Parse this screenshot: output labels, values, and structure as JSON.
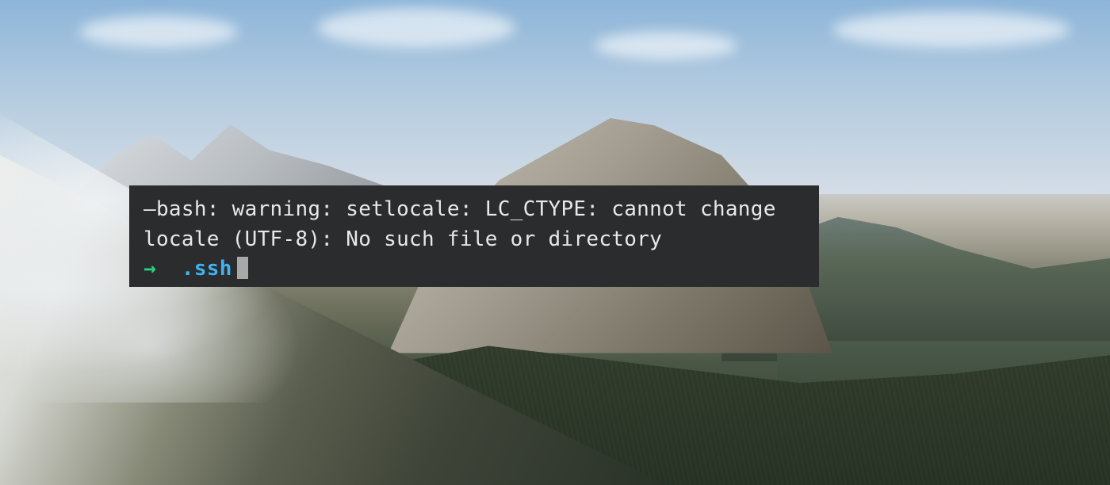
{
  "terminal": {
    "output_line_1": "—bash: warning: setlocale: LC_CTYPE: cannot change",
    "output_line_2": "locale (UTF-8): No such file or directory",
    "prompt_symbol": "→",
    "prompt_cwd": ".ssh",
    "colors": {
      "bg": "#2a2c2e",
      "text": "#e8e8e8",
      "prompt_arrow": "#28d178",
      "prompt_dir": "#3fb4f0",
      "cursor": "#a8a8a8"
    }
  }
}
